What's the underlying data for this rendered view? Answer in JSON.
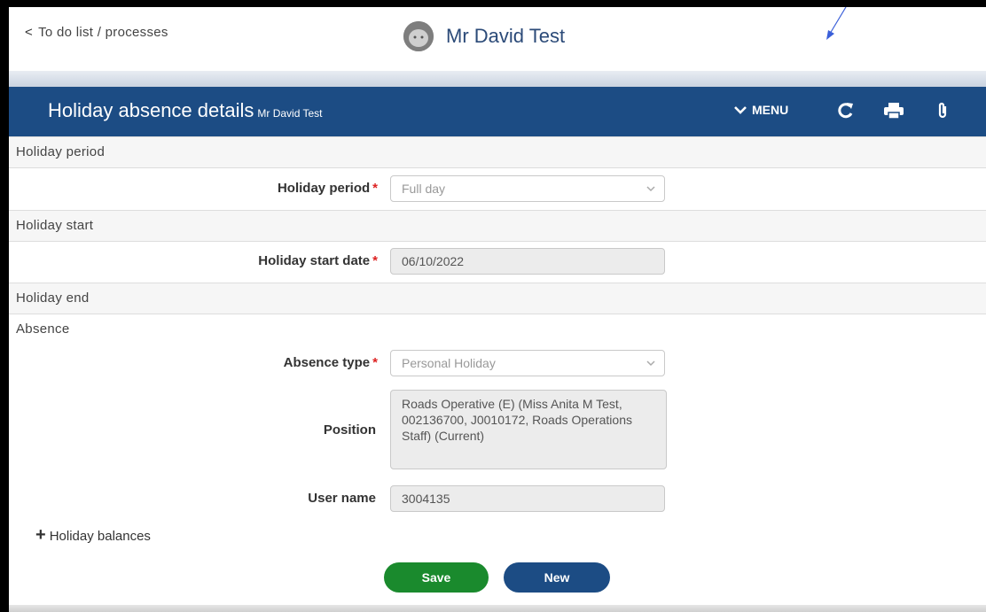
{
  "topbar": {
    "back_label": "To do list / processes",
    "user_name": "Mr David Test"
  },
  "header": {
    "title": "Holiday absence details",
    "subtitle": "Mr David Test",
    "menu_label": "MENU",
    "icons": [
      "refresh-icon",
      "print-icon",
      "paperclip-icon"
    ]
  },
  "sections": {
    "holiday_period": "Holiday period",
    "holiday_start": "Holiday start",
    "holiday_end": "Holiday end",
    "absence": "Absence"
  },
  "fields": {
    "holiday_period": {
      "label": "Holiday period",
      "required": "*",
      "value": "Full day"
    },
    "holiday_start_date": {
      "label": "Holiday start date",
      "required": "*",
      "value": "06/10/2022"
    },
    "absence_type": {
      "label": "Absence type",
      "required": "*",
      "value": "Personal Holiday"
    },
    "position": {
      "label": "Position",
      "value": "Roads Operative (E) (Miss Anita M Test, 002136700, J0010172, Roads Operations Staff) (Current)"
    },
    "user_name": {
      "label": "User name",
      "value": "3004135"
    }
  },
  "holiday_balances": {
    "label": "Holiday balances"
  },
  "buttons": {
    "save": "Save",
    "new": "New"
  },
  "colors": {
    "header": "#1c4c84",
    "save": "#1a8a2d",
    "new": "#1c4c84",
    "required": "#dd2222"
  }
}
